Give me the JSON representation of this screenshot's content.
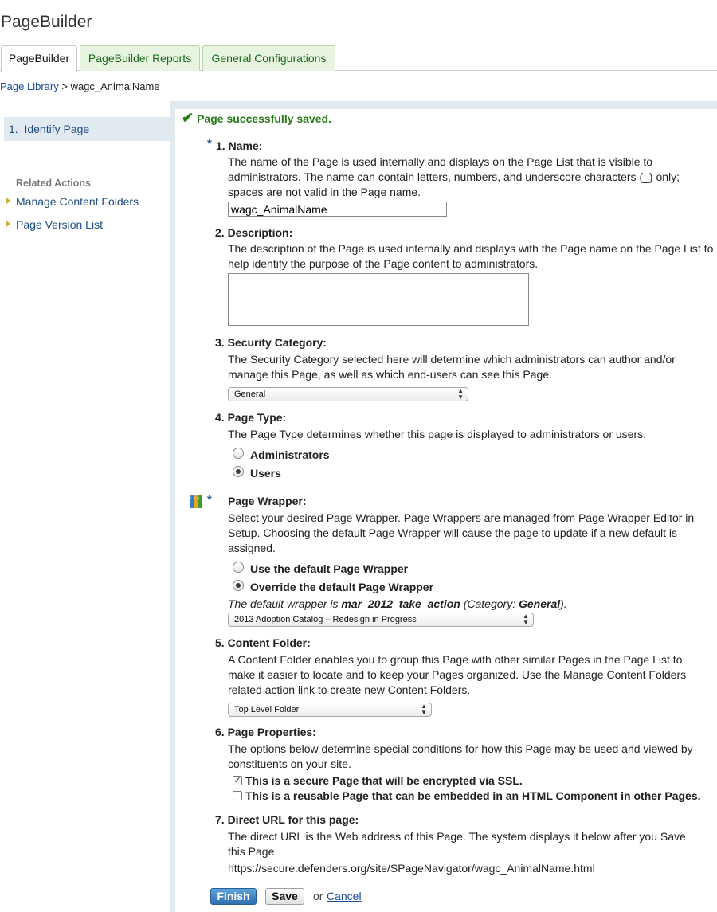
{
  "app": {
    "title": "PageBuilder"
  },
  "tabs": [
    {
      "label": "PageBuilder",
      "active": true
    },
    {
      "label": "PageBuilder Reports",
      "active": false
    },
    {
      "label": "General Configurations",
      "active": false
    }
  ],
  "breadcrumb": {
    "root": "Page Library",
    "separator": ">",
    "current": "wagc_AnimalName"
  },
  "sidebar": {
    "steps": [
      {
        "number": "1.",
        "label": "Identify Page"
      }
    ],
    "related_title": "Related Actions",
    "related_links": [
      "Manage Content Folders",
      "Page Version List"
    ]
  },
  "status": {
    "message": "Page successfully saved."
  },
  "form": {
    "name": {
      "required_mark": "*",
      "label": "1. Name:",
      "desc": "The name of the Page is used internally and displays on the Page List that is visible to administrators. The name can contain letters, numbers, and underscore characters (_) only; spaces are not valid in the Page name.",
      "value": "wagc_AnimalName"
    },
    "description": {
      "label": "2. Description:",
      "desc": "The description of the Page is used internally and displays with the Page name on the Page List to help identify the purpose of the Page content to administrators.",
      "value": ""
    },
    "security": {
      "label": "3. Security Category:",
      "desc": "The Security Category selected here will determine which administrators can author and/or manage this Page, as well as which end-users can see this Page.",
      "selected": "General"
    },
    "page_type": {
      "label": "4. Page Type:",
      "desc": "The Page Type determines whether this page is displayed to administrators or users.",
      "options": [
        {
          "label": "Administrators",
          "checked": false
        },
        {
          "label": "Users",
          "checked": true
        }
      ]
    },
    "wrapper": {
      "required_mark": "*",
      "icon": "people-icon",
      "label": "Page Wrapper:",
      "desc": "Select your desired Page Wrapper. Page Wrappers are managed from Page Wrapper Editor in Setup. Choosing the default Page Wrapper will cause the page to update if a new default is assigned.",
      "options": [
        {
          "label": "Use the default Page Wrapper",
          "checked": false
        },
        {
          "label": "Override the default Page Wrapper",
          "checked": true
        }
      ],
      "note_prefix": "The default wrapper is ",
      "note_wrapper": "mar_2012_take_action",
      "note_mid": " (Category: ",
      "note_category": "General",
      "note_suffix": ").",
      "selected": "2013 Adoption Catalog – Redesign in Progress"
    },
    "content_folder": {
      "label": "5. Content Folder:",
      "desc": "A Content Folder enables you to group this Page with other similar Pages in the Page List to make it easier to locate and to keep your Pages organized. Use the Manage Content Folders related action link to create new Content Folders.",
      "selected": "Top Level Folder"
    },
    "properties": {
      "label": "6. Page Properties:",
      "desc": "The options below determine special conditions for how this Page may be used and viewed by constituents on your site.",
      "options": [
        {
          "label": "This is a secure Page that will be encrypted via SSL.",
          "checked": true
        },
        {
          "label": "This is a reusable Page that can be embedded in an HTML Component in other Pages.",
          "checked": false
        }
      ]
    },
    "direct_url": {
      "label": "7. Direct URL for this page:",
      "desc": "The direct URL is the Web address of this Page. The system displays it below after you Save this Page.",
      "url": "https://secure.defenders.org/site/SPageNavigator/wagc_AnimalName.html"
    }
  },
  "actions": {
    "finish": "Finish",
    "save": "Save",
    "or": "or",
    "cancel": "Cancel"
  },
  "colors": {
    "accent": "#2f6fb1",
    "success": "#2a7a17",
    "tab_bg": "#e7f4df",
    "sidebar_band": "#e3e9f0"
  }
}
